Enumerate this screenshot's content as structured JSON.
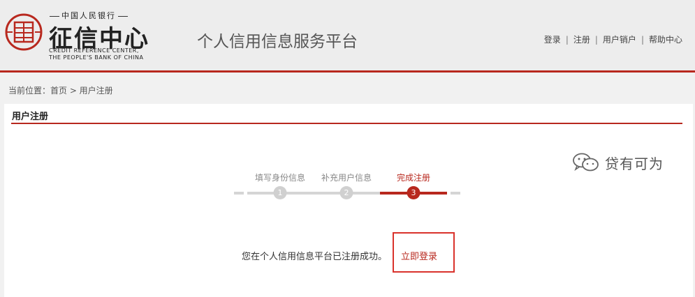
{
  "header": {
    "logo_top": "中国人民银行",
    "logo_main": "征信中心",
    "logo_en_line1": "CREDIT REFERENCE CENTER,",
    "logo_en_line2": "THE PEOPLE'S BANK OF CHINA",
    "site_title": "个人信用信息服务平台",
    "links": [
      "登录",
      "注册",
      "用户销户",
      "帮助中心"
    ],
    "link_separator": "|"
  },
  "breadcrumb": "当前位置：首页 > 用户注册",
  "panel": {
    "title": "用户注册"
  },
  "steps": {
    "items": [
      {
        "label": "填写身份信息",
        "number": "1",
        "state": "done"
      },
      {
        "label": "补充用户信息",
        "number": "2",
        "state": "done"
      },
      {
        "label": "完成注册",
        "number": "3",
        "state": "active"
      }
    ],
    "current": 3
  },
  "message": {
    "text": "您在个人信用信息平台已注册成功。",
    "login_link": "立即登录"
  },
  "watermark": {
    "icon": "wechat-official-account-icon",
    "text": "贷有可为"
  },
  "colors": {
    "accent": "#b8281e",
    "highlight_box": "#d9322b",
    "header_bg": "#ededed",
    "page_bg": "#f1f1f1",
    "step_inactive": "#d0d0d0"
  }
}
